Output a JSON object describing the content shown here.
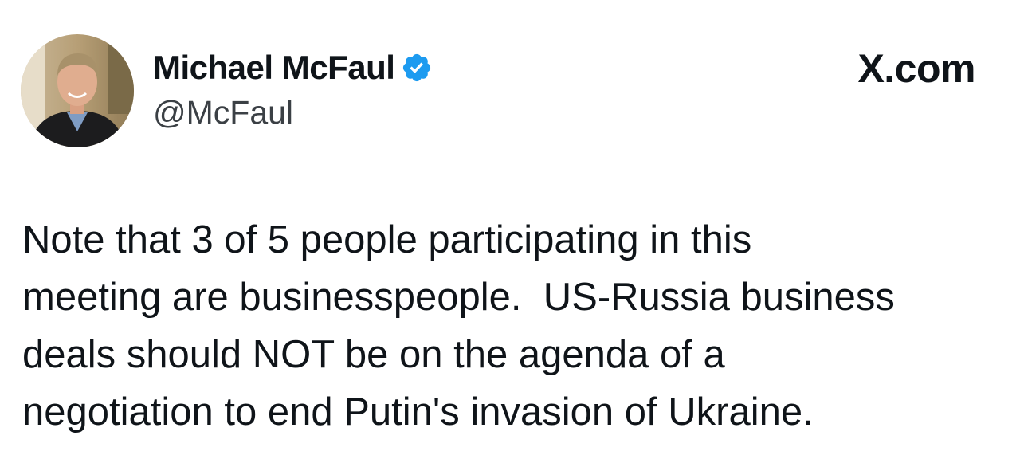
{
  "author": {
    "name": "Michael McFaul",
    "handle": "@McFaul",
    "verified": true
  },
  "site": {
    "label": "X.com"
  },
  "tweet": {
    "lines": [
      "Note that 3 of 5 people participating in this",
      "meeting are businesspeople.  US-Russia business",
      "deals should NOT be on the agenda of a",
      "negotiation to end Putin's invasion of Ukraine."
    ]
  },
  "icons": {
    "verified": "verified-check-badge"
  },
  "colors": {
    "text": "#0f1419",
    "handle": "#3b4045",
    "verified": "#1d9bf0",
    "background": "#ffffff"
  }
}
